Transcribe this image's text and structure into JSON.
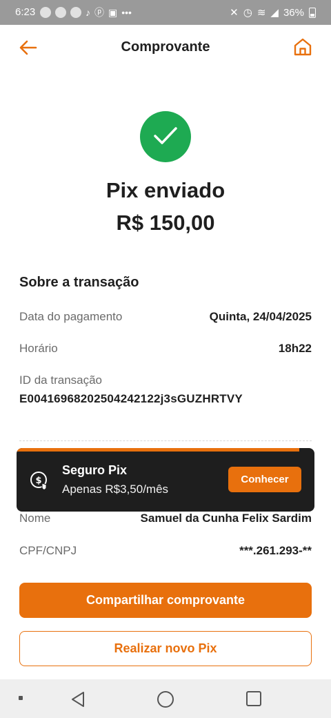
{
  "status_bar": {
    "time": "6:23",
    "battery": "36%"
  },
  "header": {
    "title": "Comprovante"
  },
  "result": {
    "status": "Pix enviado",
    "amount": "R$ 150,00"
  },
  "transaction": {
    "section_title": "Sobre a transação",
    "rows": [
      {
        "label": "Data do pagamento",
        "value": "Quinta, 24/04/2025"
      },
      {
        "label": "Horário",
        "value": "18h22"
      }
    ],
    "id_label": "ID da transação",
    "id_value": "E00416968202504242122j3sGUZHRTVY"
  },
  "recipient": {
    "rows": [
      {
        "label": "Nome",
        "value": "Samuel da Cunha Felix Sardim"
      },
      {
        "label": "CPF/CNPJ",
        "value": "***.261.293-**"
      }
    ]
  },
  "toast": {
    "title": "Seguro Pix",
    "subtitle": "Apenas R$3,50/mês",
    "button_label": "Conhecer",
    "progress": 0.95
  },
  "actions": {
    "share_label": "Compartilhar comprovante",
    "new_pix_label": "Realizar novo Pix"
  },
  "colors": {
    "accent": "#e8700d",
    "success": "#1eaa52",
    "toast_bg": "#1e1e1e"
  }
}
